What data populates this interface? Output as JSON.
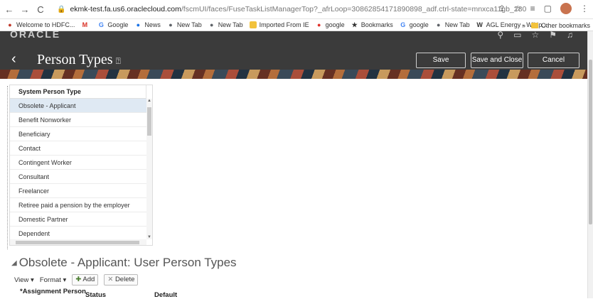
{
  "browser": {
    "url_host": "ekmk-test.fa.us6.oraclecloud.com",
    "url_path": "/fscmUI/faces/FuseTaskListManagerTop?_afrLoop=30862854171890898_adf.ctrl-state=mnxca11gb_280",
    "bookmarks": [
      {
        "label": "Welcome to HDFC...",
        "icon": "hdfc-icon",
        "color": "#c0392b"
      },
      {
        "label": "",
        "icon": "gmail-icon",
        "color": "#d93025"
      },
      {
        "label": "Google",
        "icon": "google-icon",
        "color": "#4285f4"
      },
      {
        "label": "News",
        "icon": "news-icon",
        "color": "#1a73e8"
      },
      {
        "label": "New Tab",
        "icon": "globe-icon",
        "color": "#5f6368"
      },
      {
        "label": "New Tab",
        "icon": "globe-icon",
        "color": "#5f6368"
      },
      {
        "label": "Imported From IE",
        "icon": "folder-icon",
        "color": "#f2c23c"
      },
      {
        "label": "google",
        "icon": "opera-icon",
        "color": "#e0322b"
      },
      {
        "label": "Bookmarks",
        "icon": "star-icon",
        "color": "#333333"
      },
      {
        "label": "google",
        "icon": "google-icon",
        "color": "#4285f4"
      },
      {
        "label": "New Tab",
        "icon": "globe-icon",
        "color": "#5f6368"
      },
      {
        "label": "AGL Energy - Wikip...",
        "icon": "wikipedia-icon",
        "color": "#333333"
      }
    ],
    "other_bookmarks": "Other bookmarks",
    "more_chevron": "»"
  },
  "header": {
    "logo": "ORACLE",
    "title": "Person Types",
    "help_glyph": "⍰",
    "save_label": "Save",
    "save_close_label": "Save and Close",
    "cancel_label": "Cancel"
  },
  "table": {
    "column_header": "System Person Type",
    "rows": [
      "Obsolete - Applicant",
      "Benefit Nonworker",
      "Beneficiary",
      "Contact",
      "Contingent Worker",
      "Consultant",
      "Freelancer",
      "Retiree paid a pension by the employer",
      "Domestic Partner",
      "Dependent"
    ],
    "selected_index": 0
  },
  "section": {
    "title": "Obsolete - Applicant: User Person Types",
    "view_label": "View ▾",
    "format_label": "Format ▾",
    "add_label": "Add",
    "delete_label": "Delete",
    "columns": [
      "*Assignment Person",
      "Status",
      "Default"
    ]
  }
}
